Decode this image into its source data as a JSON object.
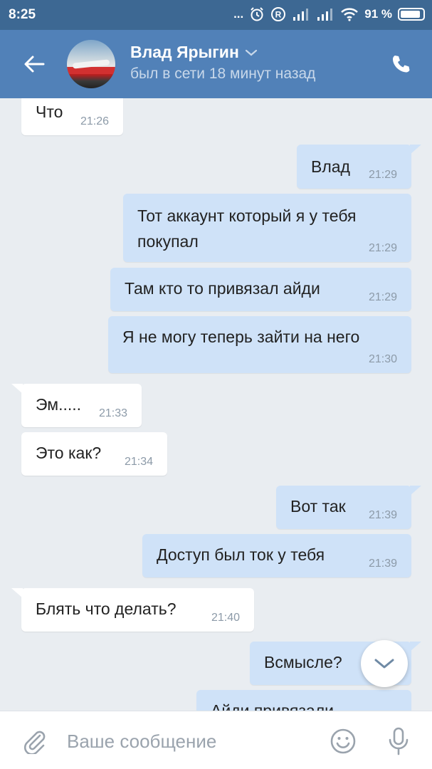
{
  "status_bar": {
    "time": "8:25",
    "dots": "...",
    "battery_percent": "91 %",
    "battery_level": 0.91
  },
  "header": {
    "contact_name": "Влад Ярыгин",
    "contact_status": "был в сети 18 минут назад"
  },
  "messages": [
    {
      "dir": "in",
      "lines": [
        "Что"
      ],
      "time": "21:26"
    },
    {
      "dir": "out",
      "lines": [
        "Влад"
      ],
      "time": "21:29"
    },
    {
      "dir": "out",
      "lines": [
        "Тот аккаунт который я у тебя",
        "покупал"
      ],
      "time": "21:29"
    },
    {
      "dir": "out",
      "lines": [
        "Там кто то привязал айди"
      ],
      "time": "21:29"
    },
    {
      "dir": "out",
      "lines": [
        "Я не могу теперь зайти на него"
      ],
      "time": "21:30"
    },
    {
      "dir": "in",
      "lines": [
        "Эм....."
      ],
      "time": "21:33"
    },
    {
      "dir": "in",
      "lines": [
        "Это как?"
      ],
      "time": "21:34"
    },
    {
      "dir": "out",
      "lines": [
        "Вот так"
      ],
      "time": "21:39"
    },
    {
      "dir": "out",
      "lines": [
        "Доступ был ток у тебя"
      ],
      "time": "21:39"
    },
    {
      "dir": "in",
      "lines": [
        "Блять что делать?"
      ],
      "time": "21:40"
    },
    {
      "dir": "out",
      "lines": [
        "Всмысле?"
      ],
      "time": ""
    },
    {
      "dir": "out",
      "lines": [
        "Айди привязали"
      ],
      "time": ""
    }
  ],
  "input": {
    "placeholder": "Ваше сообщение"
  },
  "colors": {
    "status_bar": "#3d6893",
    "header": "#5181b8",
    "chat_background": "#e9edf1",
    "incoming_bubble": "#ffffff",
    "outgoing_bubble": "#cfe2f8"
  },
  "icons": {
    "back": "arrow-left-icon",
    "name_dropdown": "chevron-down-icon",
    "call": "phone-icon",
    "scroll_down": "chevron-down-icon",
    "attach": "paperclip-icon",
    "emoji": "smiley-icon",
    "voice": "microphone-icon"
  }
}
